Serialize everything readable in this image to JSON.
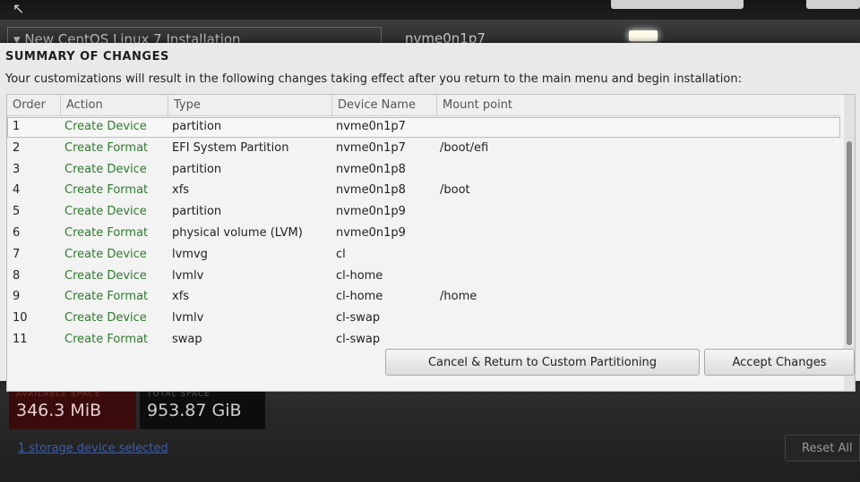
{
  "background": {
    "installer_title": "New CentOS Linux 7 Installation",
    "selected_device": "nvme0n1p7",
    "available_space_label": "AVAILABLE SPACE",
    "available_space_value": "346.3 MiB",
    "total_space_label": "TOTAL SPACE",
    "total_space_value": "953.87 GiB",
    "storage_link": "1 storage device selected",
    "reset_button": "Reset All"
  },
  "dialog": {
    "title": "SUMMARY OF CHANGES",
    "description": "Your customizations will result in the following changes taking effect after you return to the main menu and begin installation:",
    "columns": {
      "order": "Order",
      "action": "Action",
      "type": "Type",
      "device": "Device Name",
      "mount": "Mount point"
    },
    "rows": [
      {
        "order": "1",
        "action": "Create Device",
        "type": "partition",
        "device": "nvme0n1p7",
        "mount": ""
      },
      {
        "order": "2",
        "action": "Create Format",
        "type": "EFI System Partition",
        "device": "nvme0n1p7",
        "mount": "/boot/efi"
      },
      {
        "order": "3",
        "action": "Create Device",
        "type": "partition",
        "device": "nvme0n1p8",
        "mount": ""
      },
      {
        "order": "4",
        "action": "Create Format",
        "type": "xfs",
        "device": "nvme0n1p8",
        "mount": "/boot"
      },
      {
        "order": "5",
        "action": "Create Device",
        "type": "partition",
        "device": "nvme0n1p9",
        "mount": ""
      },
      {
        "order": "6",
        "action": "Create Format",
        "type": "physical volume (LVM)",
        "device": "nvme0n1p9",
        "mount": ""
      },
      {
        "order": "7",
        "action": "Create Device",
        "type": "lvmvg",
        "device": "cl",
        "mount": ""
      },
      {
        "order": "8",
        "action": "Create Device",
        "type": "lvmlv",
        "device": "cl-home",
        "mount": ""
      },
      {
        "order": "9",
        "action": "Create Format",
        "type": "xfs",
        "device": "cl-home",
        "mount": "/home"
      },
      {
        "order": "10",
        "action": "Create Device",
        "type": "lvmlv",
        "device": "cl-swap",
        "mount": ""
      },
      {
        "order": "11",
        "action": "Create Format",
        "type": "swap",
        "device": "cl-swap",
        "mount": ""
      }
    ],
    "cancel_button": "Cancel & Return to Custom Partitioning",
    "accept_button": "Accept Changes"
  },
  "colors": {
    "action_text": "#2f7a2f",
    "dialog_bg": "#e9e9e9",
    "available_space_bg": "#3a0b0b"
  }
}
